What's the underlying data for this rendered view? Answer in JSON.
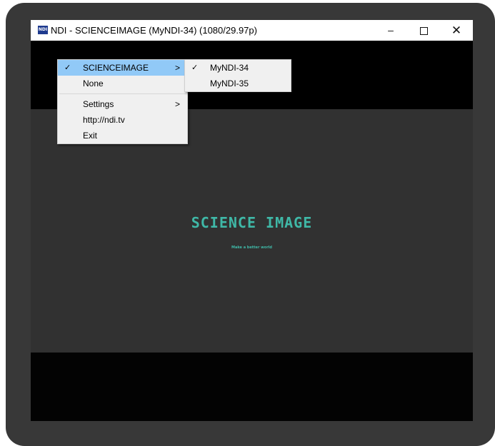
{
  "window": {
    "icon_text": "NDI",
    "title": "NDI - SCIENCEIMAGE (MyNDI-34) (1080/29.97p)",
    "min_symbol": "–",
    "close_symbol": "✕"
  },
  "content": {
    "logo_text": "SCIENCE IMAGE",
    "tagline": "Make a better world"
  },
  "context_menu": {
    "items": [
      {
        "label": "SCIENCEIMAGE",
        "checked": true,
        "has_submenu": true,
        "highlighted": true
      },
      {
        "label": "None"
      },
      {
        "label": "Settings",
        "has_submenu": true
      },
      {
        "label": "http://ndi.tv"
      },
      {
        "label": "Exit"
      }
    ],
    "check_symbol": "✓",
    "arrow_symbol": ">"
  },
  "submenu": {
    "items": [
      {
        "label": "MyNDI-34",
        "checked": true
      },
      {
        "label": "MyNDI-35"
      }
    ]
  },
  "colors": {
    "accent": "#3fb8a7",
    "highlight": "#91c9f7"
  }
}
